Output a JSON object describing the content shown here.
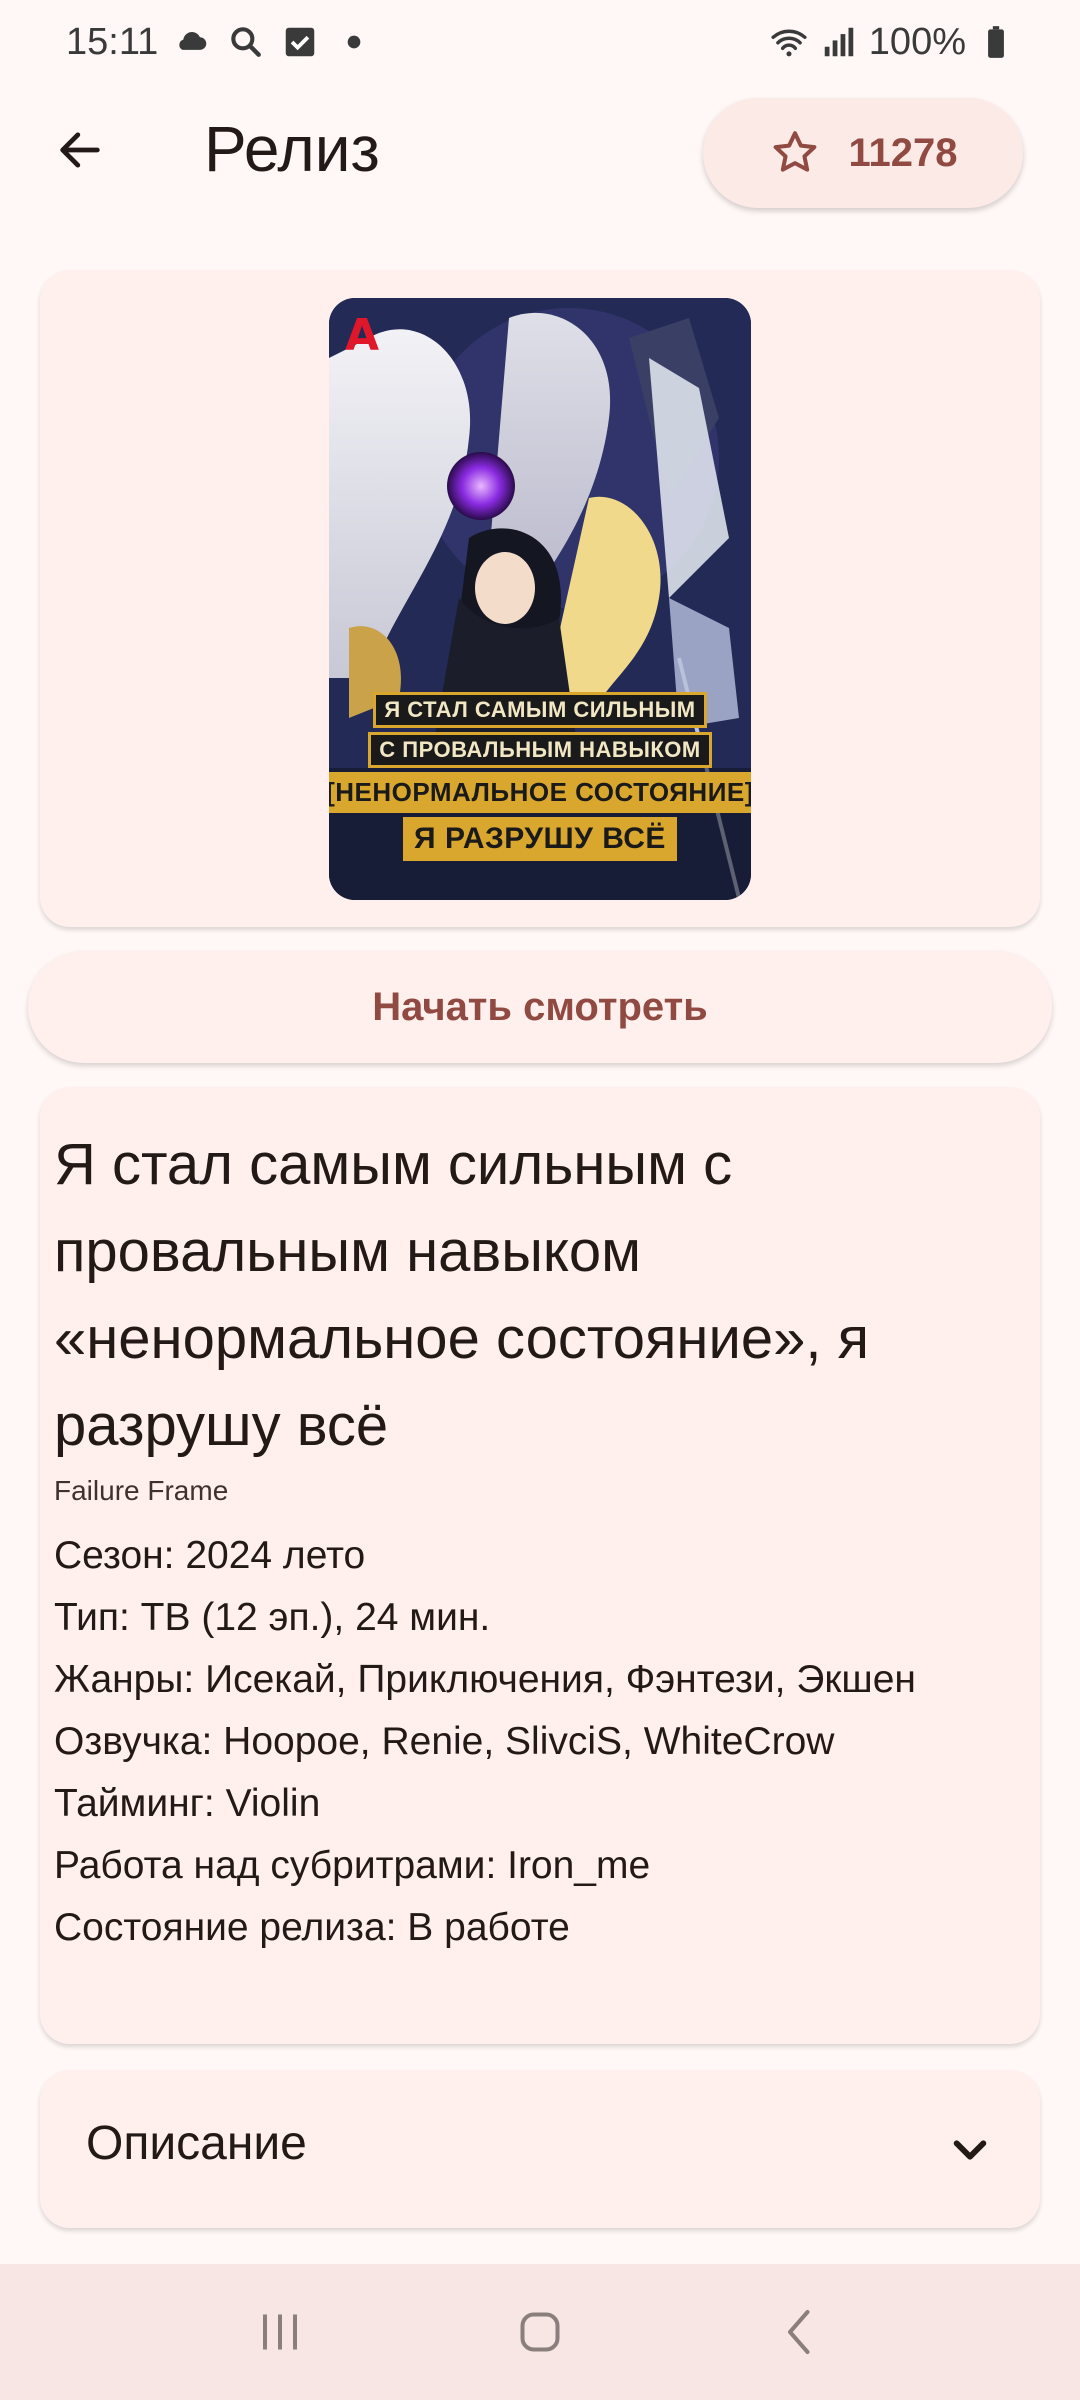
{
  "status_bar": {
    "time": "15:11",
    "battery": "100%",
    "icons_left": [
      "cloud-icon",
      "search-icon",
      "checkbox-icon",
      "dot-icon"
    ],
    "icons_right": [
      "wifi-icon",
      "signal-icon",
      "battery-icon"
    ]
  },
  "app_bar": {
    "title": "Релиз",
    "favorites_count": "11278"
  },
  "poster": {
    "logo": "A",
    "title_lines": [
      "Я стал самым сильным",
      "с провальным навыком",
      "[ненормальное состояние]",
      "я разрушу всё"
    ]
  },
  "actions": {
    "watch_label": "Начать смотреть"
  },
  "info": {
    "title": "Я стал самым сильным с провальным навыком «ненормальное состояние», я разрушу всё",
    "alt_title": "Failure Frame",
    "lines": [
      "Сезон: 2024 лето",
      "Тип: ТВ (12 эп.), 24 мин.",
      "Жанры: Исекай, Приключения, Фэнтези, Экшен",
      "Озвучка: Hoopoe, Renie, SlivciS, WhiteCrow",
      "Тайминг: Violin",
      "Работа над субритрами: Iron_me",
      "Состояние релиза: В работе"
    ]
  },
  "description": {
    "label": "Описание"
  },
  "colors": {
    "accent": "#904a42",
    "background": "#fff8f6",
    "card": "#fff0ee"
  }
}
